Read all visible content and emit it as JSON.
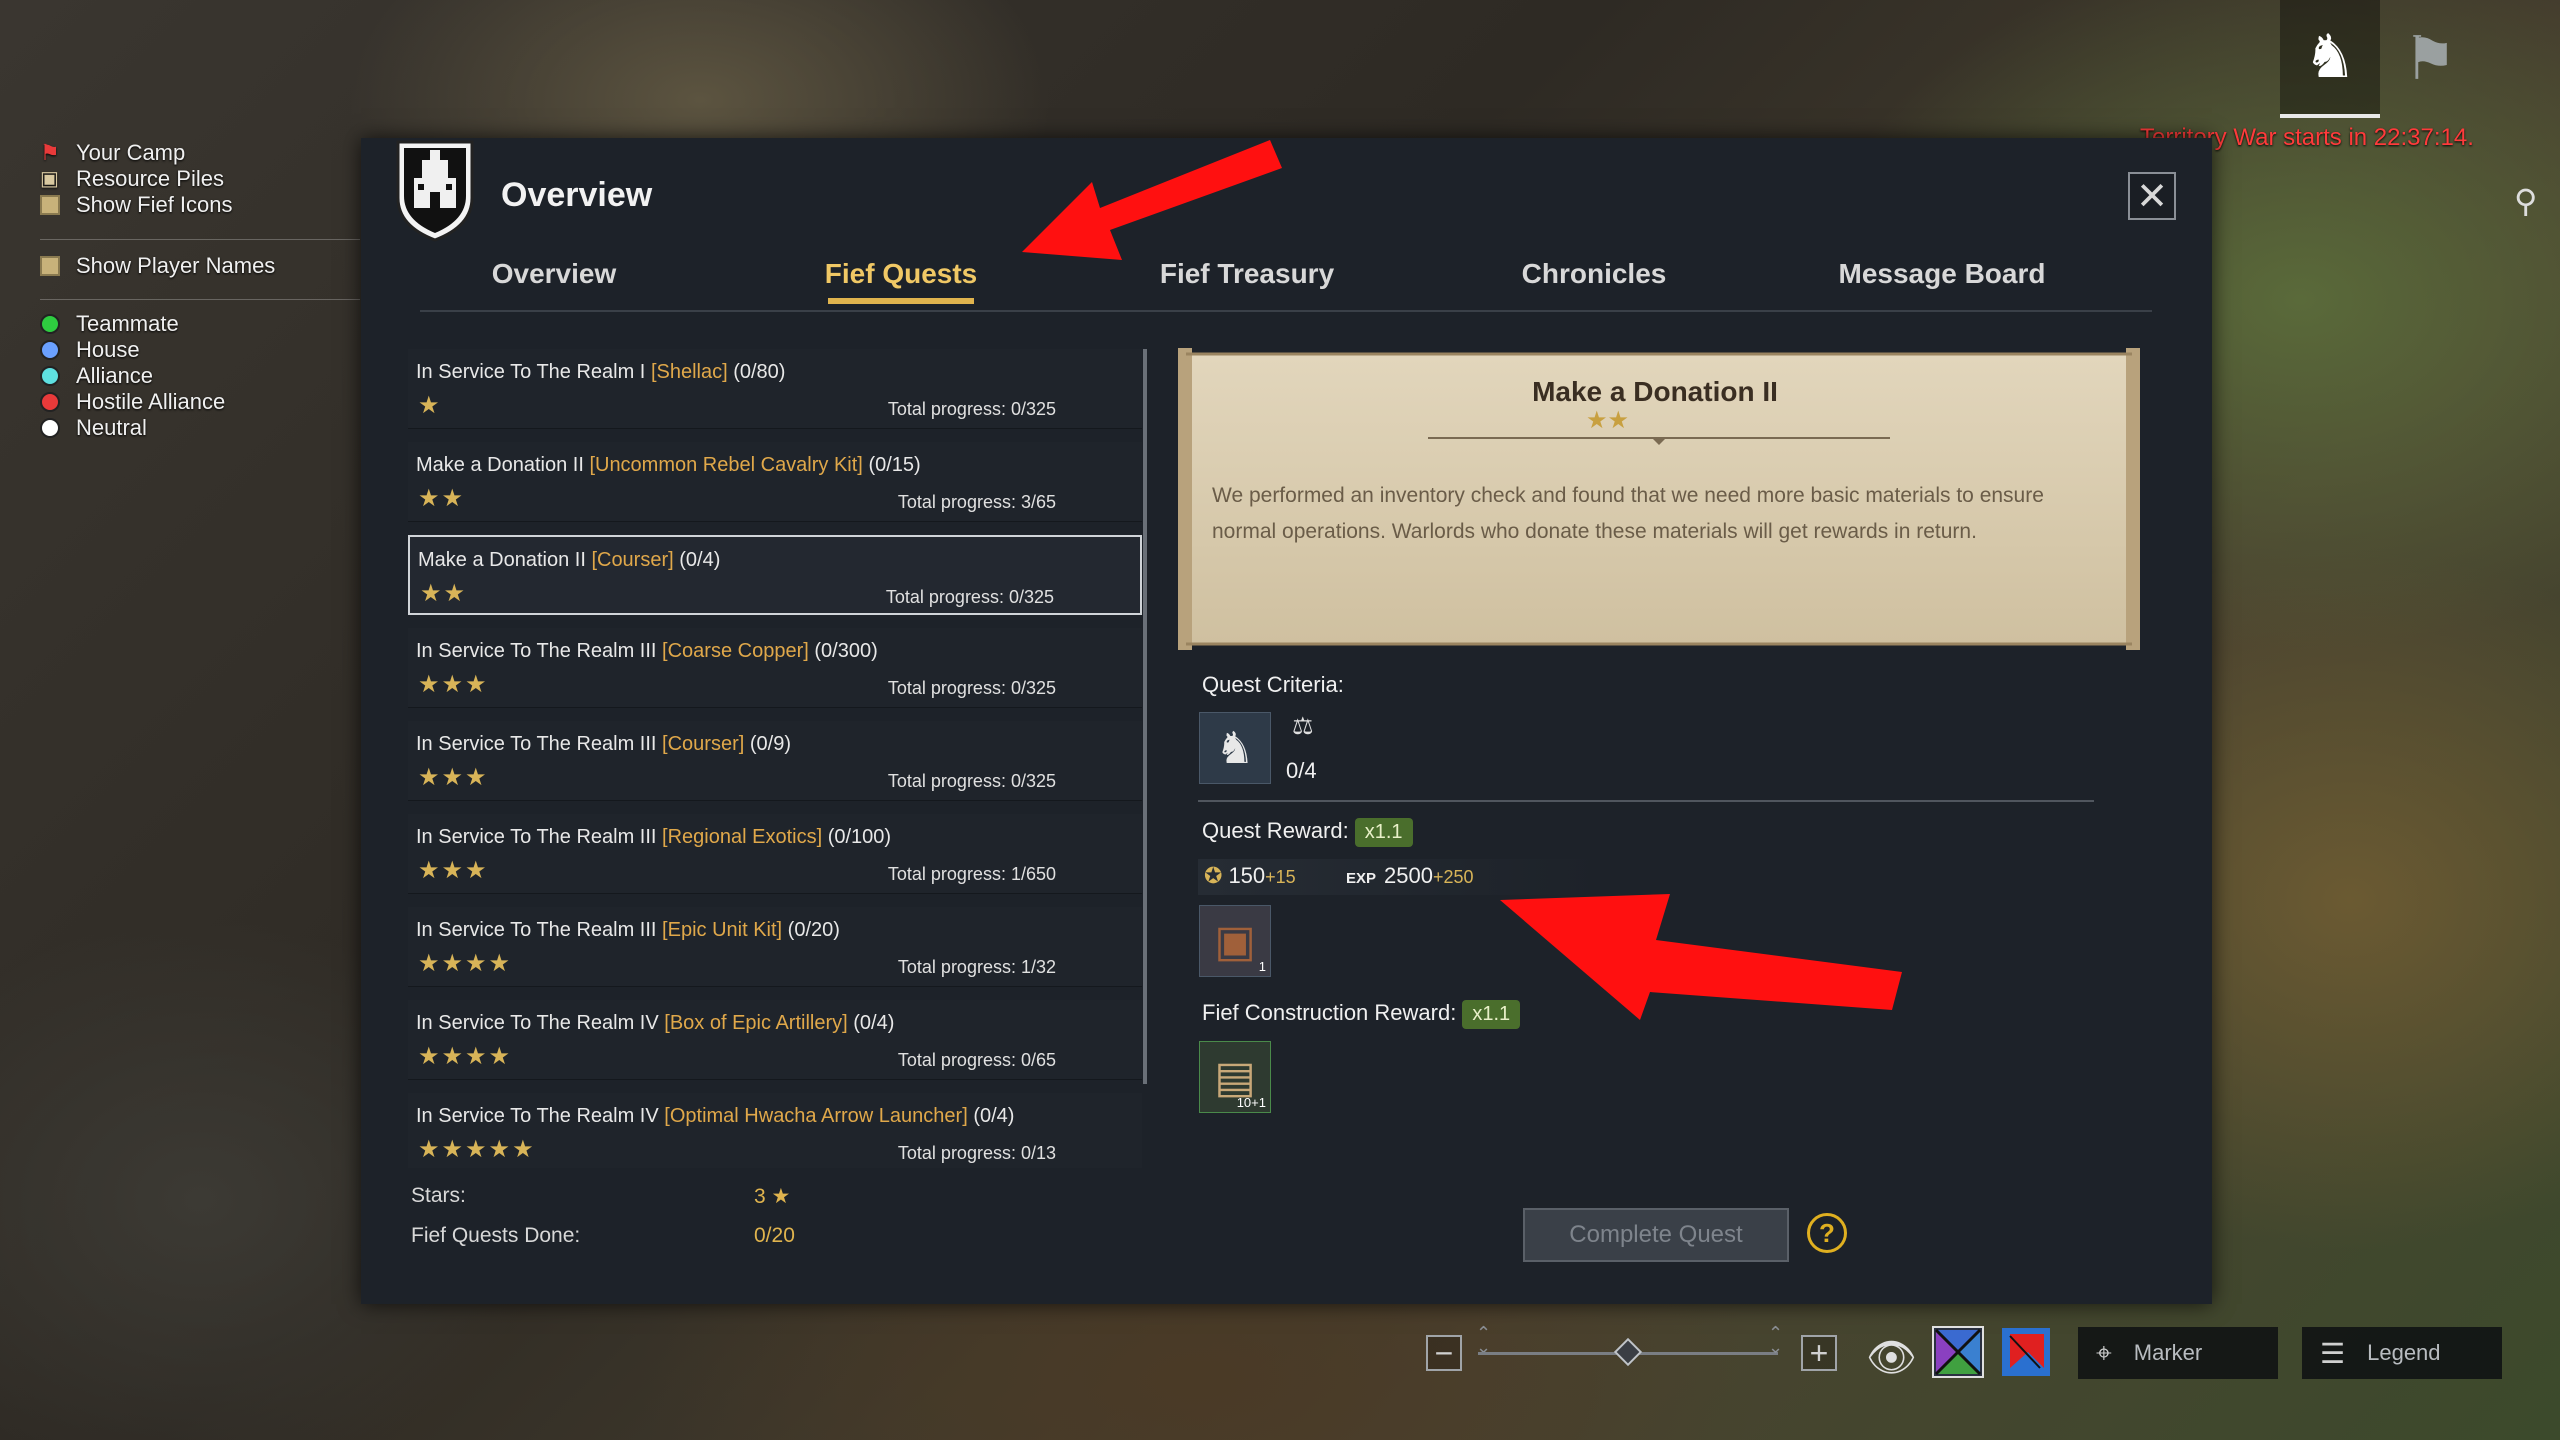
{
  "map_legend": {
    "items": [
      {
        "label": "Your Camp",
        "icon": "red-flag-icon"
      },
      {
        "label": "Resource Piles",
        "icon": "resource-pile-icon"
      },
      {
        "label": "Show Fief Icons",
        "icon": "checkbox"
      },
      {
        "label": "Show Player Names",
        "icon": "checkbox"
      }
    ],
    "relations": [
      {
        "label": "Teammate",
        "color": "#2ecc40"
      },
      {
        "label": "House",
        "color": "#6aa0ff"
      },
      {
        "label": "Alliance",
        "color": "#5ee0e0"
      },
      {
        "label": "Hostile Alliance",
        "color": "#e83a3a"
      },
      {
        "label": "Neutral",
        "color": "#ffffff"
      }
    ]
  },
  "top_right": {
    "tabs": [
      {
        "icon": "horse-icon",
        "active": true
      },
      {
        "icon": "flag-icon",
        "active": false
      }
    ],
    "war_timer": "Territory War starts in 22:37:14."
  },
  "panel": {
    "title": "Overview",
    "tabs": [
      "Overview",
      "Fief Quests",
      "Fief Treasury",
      "Chronicles",
      "Message Board"
    ],
    "active_tab": "Fief Quests"
  },
  "quests": [
    {
      "name": "In Service To The Realm I",
      "material": "[Shellac]",
      "count": "(0/80)",
      "stars": "★",
      "progress": "Total progress: 0/325"
    },
    {
      "name": "Make a Donation II",
      "material": "[Uncommon Rebel Cavalry Kit]",
      "count": "(0/15)",
      "stars": "★★",
      "progress": "Total progress: 3/65"
    },
    {
      "name": "Make a Donation II",
      "material": "[Courser]",
      "count": "(0/4)",
      "stars": "★★",
      "progress": "Total progress: 0/325",
      "selected": true
    },
    {
      "name": "In Service To The Realm III",
      "material": "[Coarse Copper]",
      "count": "(0/300)",
      "stars": "★★★",
      "progress": "Total progress: 0/325"
    },
    {
      "name": "In Service To The Realm III",
      "material": "[Courser]",
      "count": "(0/9)",
      "stars": "★★★",
      "progress": "Total progress: 0/325"
    },
    {
      "name": "In Service To The Realm III",
      "material": "[Regional Exotics]",
      "count": "(0/100)",
      "stars": "★★★",
      "progress": "Total progress: 1/650"
    },
    {
      "name": "In Service To The Realm III",
      "material": "[Epic Unit Kit]",
      "count": "(0/20)",
      "stars": "★★★★",
      "progress": "Total progress: 1/32"
    },
    {
      "name": "In Service To The Realm IV",
      "material": "[Box of Epic Artillery]",
      "count": "(0/4)",
      "stars": "★★★★",
      "progress": "Total progress: 0/65"
    },
    {
      "name": "In Service To The Realm IV",
      "material": "[Optimal Hwacha Arrow Launcher]",
      "count": "(0/4)",
      "stars": "★★★★★",
      "progress": "Total progress: 0/13"
    }
  ],
  "summary": {
    "stars_label": "Stars:",
    "stars_value": "3",
    "done_label": "Fief Quests Done:",
    "done_value": "0/20"
  },
  "detail": {
    "title": "Make a Donation II",
    "stars": "★★",
    "description": "We performed an inventory check and found that we need more basic materials to ensure normal operations. Warlords who donate these materials will get rewards in return.",
    "criteria_label": "Quest Criteria:",
    "criteria_count": "0/4",
    "reward_label": "Quest Reward:",
    "reward_mult": "x1.1",
    "reward_honor": "150",
    "reward_honor_bonus": "+15",
    "reward_exp_label": "EXP",
    "reward_exp": "2500",
    "reward_exp_bonus": "+250",
    "reward_item_count": "1",
    "construction_label": "Fief Construction Reward:",
    "construction_mult": "x1.1",
    "construction_item_count": "10+1",
    "complete_button": "Complete Quest",
    "help": "?"
  },
  "bottom_bar": {
    "zoom_level": 0.5,
    "marker_label": "Marker",
    "legend_label": "Legend"
  }
}
